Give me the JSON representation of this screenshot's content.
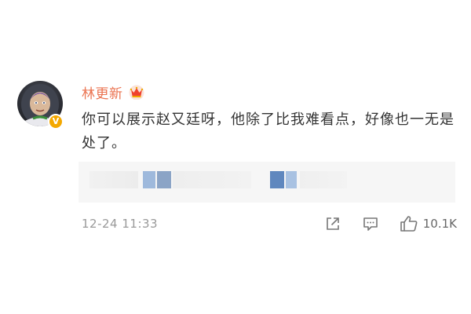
{
  "comment": {
    "author": "林更新",
    "text": "你可以展示赵又廷呀，他除了比我难看点，好像也一无是处了。",
    "timestamp": "12-24 11:33",
    "likes": "10.1K",
    "verified_badge": "V"
  },
  "colors": {
    "username": "#eb7350",
    "text": "#333333",
    "meta": "#999999",
    "verified": "#f4a800",
    "quote_bg": "#f6f6f6"
  },
  "icons": {
    "share": "share-icon",
    "reply": "comment-icon",
    "like": "thumbs-up-icon",
    "crown": "crown-icon"
  }
}
